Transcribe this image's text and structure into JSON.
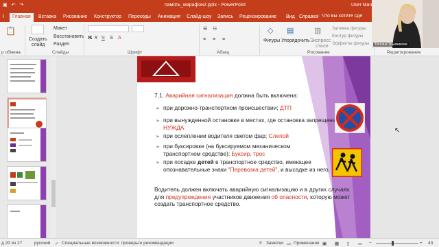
{
  "window": {
    "title": "память_марафон2.pptx - PowerPoint",
    "user": "User Mann",
    "tell_me": "Что вы хотите сде"
  },
  "tabs": [
    "Главная",
    "Вставка",
    "Рисование",
    "Конструктор",
    "Переходы",
    "Анимация",
    "Слайд-шоу",
    "Запись",
    "Рецензирование",
    "Вид",
    "Справка"
  ],
  "active_tab": "Главная",
  "ribbon": {
    "clipboard": {
      "label": "р обмена"
    },
    "slides": {
      "create": "Создать",
      "create2": "слайд",
      "maket": "Макет",
      "restore": "Восстановить",
      "section": "Раздел",
      "label": "Слайды"
    },
    "font": {
      "label": "Шрифт"
    },
    "paragraph": {
      "label": "Абзац"
    },
    "drawing": {
      "figures": "Фигуры",
      "arrange": "Упорядочить",
      "express": "Экспресс",
      "styles": "стили",
      "fill": "Заливка фигуры",
      "outline": "Контур фигуры",
      "effects": "Эффекты фигуры",
      "label": "Рисование"
    },
    "editing": {
      "label": "Редактирование"
    }
  },
  "webcam": {
    "name": "Татьяна Урывчикова"
  },
  "slide": {
    "heading_prefix": "7.1.",
    "heading_red": "Аварийная сигнализация",
    "heading_rest": "должна быть включена:",
    "items": [
      {
        "text": "при дорожно-транспортном происшествии;",
        "red": "ДТП"
      },
      {
        "text": "при вынужденной остановке в местах, где остановка запрещена;",
        "red": "НУЖДА"
      },
      {
        "text": "при ослеплении водителя светом фар;",
        "red": "Слепой"
      },
      {
        "text": "при буксировке (на буксируемом механическом транспортном средстве);",
        "red": "Буксир, трос"
      },
      {
        "text_a": "при посадке",
        "bold": "детей",
        "text_b": "в транспортное средство, имеющее опознавательные знаки",
        "red": "\"Перевозка детей\"",
        "text_c": ", и высадке из него."
      }
    ],
    "footer_a": "Водитель должен включать аварийную сигнализацию и в других случаях для",
    "footer_red1": "предупреждения",
    "footer_b": "участников движения",
    "footer_red2": "об опасности",
    "footer_c": ", которую может создать транспортное средство."
  },
  "status": {
    "slide_of": "д 20 из 27",
    "language": "русский",
    "accessibility": "Специальные возможности: проверьте рекомендации",
    "notes": "Заметки",
    "comments": "Примечания",
    "zoom": "43"
  },
  "colors": {
    "accent": "#c43e1c",
    "slide_purple": "#8e3fb0",
    "highlight_red": "#d42c1c"
  }
}
